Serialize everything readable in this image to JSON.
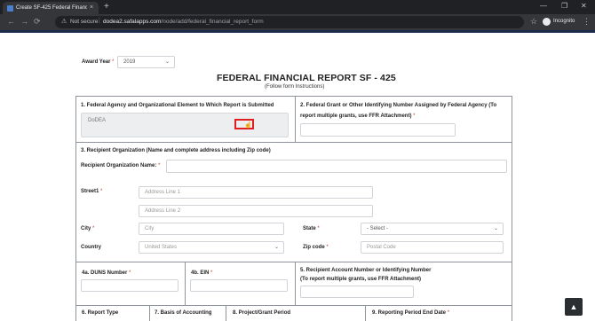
{
  "browser": {
    "tab_title": "Create SF-425 Federal Financial",
    "tab_close": "×",
    "new_tab": "+",
    "win_min": "—",
    "win_max": "❐",
    "win_close": "✕",
    "not_secure": "Not secure",
    "url_host": "dodea2.safalapps.com",
    "url_path": "/node/add/federal_financial_report_form",
    "incognito_label": "Incognito"
  },
  "form": {
    "award_year_label": "Award Year",
    "award_year_value": "2019",
    "title": "FEDERAL FINANCIAL REPORT SF - 425",
    "subtitle": "(Follow form Instructions)",
    "s1_label": "1. Federal Agency and Organizational Element to Which Report is Submitted",
    "s1_value": "DoDEA",
    "s2_label_line1": "2. Federal Grant or Other Identifying Number Assigned by Federal Agency (To",
    "s2_label_line2": "report multiple grants, use FFR Attachment)",
    "s3_label": "3. Recipient Organization (Name and complete address including Zip code)",
    "org_name_label": "Recipient Organization Name:",
    "street1_label": "Street1",
    "addr1_ph": "Address Line 1",
    "addr2_ph": "Address Line 2",
    "city_label": "City",
    "city_ph": "City",
    "state_label": "State",
    "state_value": "- Select -",
    "country_label": "Country",
    "country_value": "United States",
    "zip_label": "Zip code",
    "zip_ph": "Postal Code",
    "duns_label": "4a. DUNS Number",
    "ein_label": "4b. EIN",
    "s5_label_line1": "5. Recipient Account Number or Identifying Number",
    "s5_label_line2": "(To report multiple grants, use FFR Attachment)",
    "s6_label": "6. Report Type",
    "s7_label": "7. Basis of Accounting",
    "s8_label": "8. Project/Grant Period",
    "s9_label": "9. Reporting Period End Date",
    "required_mark": "*"
  }
}
